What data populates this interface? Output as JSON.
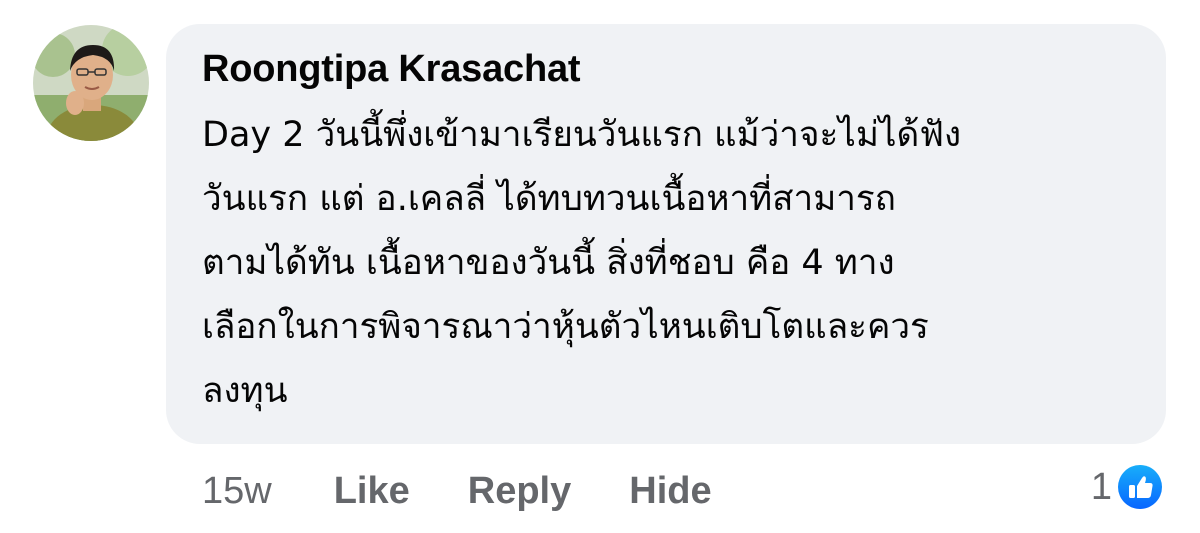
{
  "comment": {
    "author": "Roongtipa Krasachat",
    "avatar_icon": "user-avatar-photo",
    "lines": [
      "Day 2 วันนี้พึ่งเข้ามาเรียนวันแรก แม้ว่าจะไม่ได้ฟัง",
      "วันแรก แต่ อ.เคลลี่ ได้ทบทวนเนื้อหาที่สามารถ",
      "ตามได้ทัน เนื้อหาของวันนี้ สิ่งที่ชอบ คือ 4 ทาง",
      "เลือกในการพิจารณาว่าหุ้นตัวไหนเติบโตและควร",
      "ลงทุน"
    ],
    "bubble_color": "#f0f2f5"
  },
  "actions": {
    "timestamp": "15w",
    "like_label": "Like",
    "reply_label": "Reply",
    "hide_label": "Hide",
    "text_color": "#65676b"
  },
  "reactions": {
    "count": "1",
    "icon": "thumbs-up-icon",
    "badge_color": "#1877f2"
  }
}
